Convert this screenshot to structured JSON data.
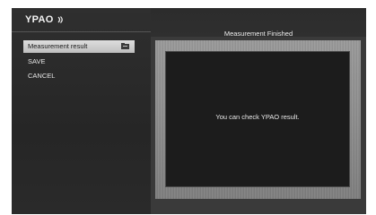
{
  "app": {
    "brand": "YPAO"
  },
  "menu": {
    "items": [
      {
        "label": "Measurement result",
        "selected": true,
        "icon": "folder-icon"
      },
      {
        "label": "SAVE",
        "selected": false
      },
      {
        "label": "CANCEL",
        "selected": false
      }
    ]
  },
  "panel": {
    "title": "Measurement Finished",
    "message": "You can check YPAO result."
  },
  "colors": {
    "background": "#2b2b2b",
    "selected_item": "#d0d0d0",
    "text": "#e6e6e6",
    "frame": "#8d8d8d"
  }
}
